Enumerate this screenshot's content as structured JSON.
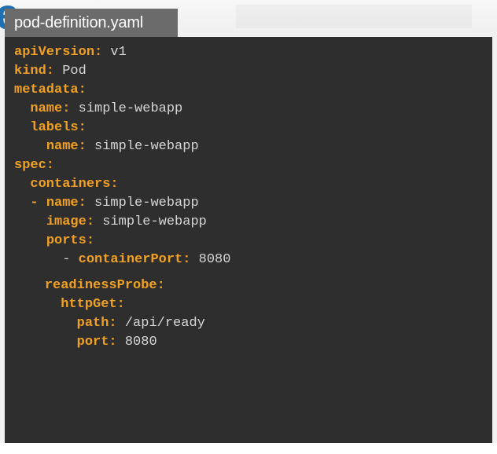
{
  "file_tab": {
    "label": "pod-definition.yaml"
  },
  "logo": {
    "letter": "e"
  },
  "code": {
    "lines": [
      {
        "indent": "",
        "key": "apiVersion:",
        "value": " v1"
      },
      {
        "indent": "",
        "key": "kind:",
        "value": " Pod"
      },
      {
        "indent": "",
        "key": "metadata:",
        "value": ""
      },
      {
        "indent": "  ",
        "key": "name:",
        "value": " simple-webapp"
      },
      {
        "indent": "  ",
        "key": "labels:",
        "value": ""
      },
      {
        "indent": "    ",
        "key": "name:",
        "value": " simple-webapp"
      },
      {
        "indent": "",
        "key": "spec:",
        "value": ""
      },
      {
        "indent": "  ",
        "key": "containers:",
        "value": ""
      },
      {
        "indent": "  - ",
        "key": "name:",
        "value": " simple-webapp"
      },
      {
        "indent": "    ",
        "key": "image:",
        "value": " simple-webapp"
      },
      {
        "indent": "    ",
        "key": "ports:",
        "value": ""
      },
      {
        "indent": "      - ",
        "key": "containerPort:",
        "value": " 8080"
      },
      {
        "indent": "    ",
        "key": "readinessProbe:",
        "value": ""
      },
      {
        "indent": "      ",
        "key": "httpGet:",
        "value": ""
      },
      {
        "indent": "        ",
        "key": "path:",
        "value": " /api/ready"
      },
      {
        "indent": "        ",
        "key": "port:",
        "value": " 8080"
      }
    ]
  },
  "colors": {
    "key": "#f0a025",
    "value": "#d6d6d6",
    "panel_bg": "#2e2e2e",
    "tab_bg": "#6b6b6b",
    "logo": "#1f6fb2"
  }
}
